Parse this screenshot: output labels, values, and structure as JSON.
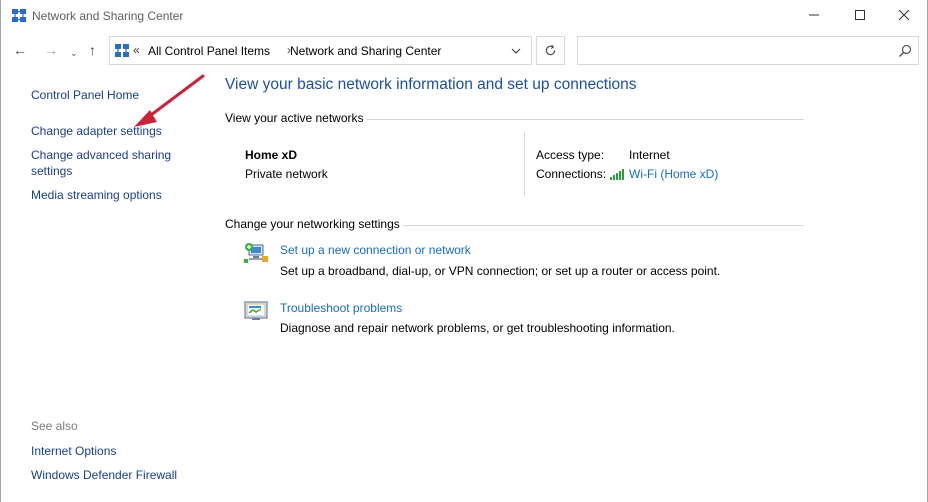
{
  "window": {
    "title": "Network and Sharing Center",
    "icon": "network-center-icon",
    "controls": {
      "minimize": "minimize-icon",
      "maximize": "maximize-icon",
      "close": "close-icon"
    }
  },
  "nav": {
    "back": "←",
    "forward": "→",
    "recent": "⌄",
    "up": "↑"
  },
  "address": {
    "overflow": "«",
    "crumbs": [
      "All Control Panel Items",
      "Network and Sharing Center"
    ],
    "separator": "›"
  },
  "search": {
    "placeholder": "",
    "value": ""
  },
  "sidebar": {
    "items": [
      {
        "label": "Control Panel Home"
      },
      {
        "label": "Change adapter settings"
      },
      {
        "label": "Change advanced sharing"
      },
      {
        "label": "settings"
      },
      {
        "label": "Media streaming options"
      }
    ],
    "see_also_title": "See also",
    "see_also": [
      {
        "label": "Internet Options"
      },
      {
        "label": "Windows Defender Firewall"
      }
    ]
  },
  "main": {
    "title": "View your basic network information and set up connections",
    "active_section": "View your active networks",
    "network": {
      "name": "Home xD",
      "type": "Private network",
      "access_label": "Access type:",
      "access_value": "Internet",
      "connections_label": "Connections:",
      "connection_link": "Wi-Fi (Home xD)"
    },
    "settings_section": "Change your networking settings",
    "tasks": [
      {
        "link": "Set up a new connection or network",
        "desc": "Set up a broadband, dial-up, or VPN connection; or set up a router or access point."
      },
      {
        "link": "Troubleshoot problems",
        "desc": "Diagnose and repair network problems, or get troubleshooting information."
      }
    ]
  },
  "colors": {
    "link": "#1a6bbf",
    "left_link": "#1a3e8a",
    "title": "#1e4e9c",
    "annotation_arrow": "#c8243a"
  }
}
